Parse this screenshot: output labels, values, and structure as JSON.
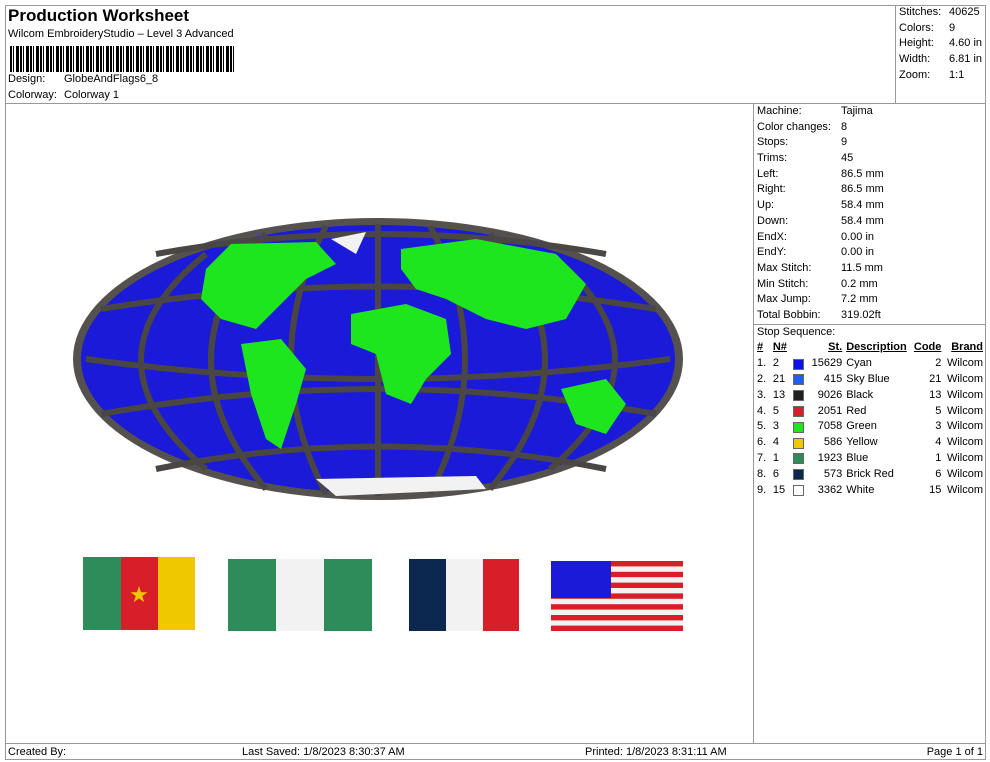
{
  "header": {
    "title": "Production Worksheet",
    "subtitle": "Wilcom EmbroideryStudio – Level 3 Advanced",
    "design_label": "Design:",
    "design": "GlobeAndFlags6_8",
    "colorway_label": "Colorway:",
    "colorway": "Colorway 1"
  },
  "summary": [
    {
      "k": "Stitches:",
      "v": "40625"
    },
    {
      "k": "Colors:",
      "v": "9"
    },
    {
      "k": "Height:",
      "v": "4.60 in"
    },
    {
      "k": "Width:",
      "v": "6.81 in"
    },
    {
      "k": "Zoom:",
      "v": "1:1"
    }
  ],
  "machine": [
    {
      "k": "Machine:",
      "v": "Tajima"
    },
    {
      "k": "Color changes:",
      "v": "8"
    },
    {
      "k": "Stops:",
      "v": "9"
    },
    {
      "k": "Trims:",
      "v": "45"
    },
    {
      "k": "Left:",
      "v": "86.5 mm"
    },
    {
      "k": "Right:",
      "v": "86.5 mm"
    },
    {
      "k": "Up:",
      "v": "58.4 mm"
    },
    {
      "k": "Down:",
      "v": "58.4 mm"
    },
    {
      "k": "EndX:",
      "v": "0.00 in"
    },
    {
      "k": "EndY:",
      "v": "0.00 in"
    },
    {
      "k": "Max Stitch:",
      "v": "11.5 mm"
    },
    {
      "k": "Min Stitch:",
      "v": "0.2 mm"
    },
    {
      "k": "Max Jump:",
      "v": "7.2 mm"
    },
    {
      "k": "Total Bobbin:",
      "v": "319.02ft"
    }
  ],
  "stop_sequence": {
    "title": "Stop Sequence:",
    "headers": [
      "#",
      "N#",
      "St.",
      "Description",
      "Code",
      "Brand"
    ],
    "rows": [
      {
        "i": "1.",
        "n": "2",
        "color": "#0a14e6",
        "st": "15629",
        "desc": "Cyan",
        "code": "2",
        "brand": "Wilcom"
      },
      {
        "i": "2.",
        "n": "21",
        "color": "#1e5ff0",
        "st": "415",
        "desc": "Sky Blue",
        "code": "21",
        "brand": "Wilcom"
      },
      {
        "i": "3.",
        "n": "13",
        "color": "#231f1c",
        "st": "9026",
        "desc": "Black",
        "code": "13",
        "brand": "Wilcom"
      },
      {
        "i": "4.",
        "n": "5",
        "color": "#d81e28",
        "st": "2051",
        "desc": "Red",
        "code": "5",
        "brand": "Wilcom"
      },
      {
        "i": "5.",
        "n": "3",
        "color": "#1ee61e",
        "st": "7058",
        "desc": "Green",
        "code": "3",
        "brand": "Wilcom"
      },
      {
        "i": "6.",
        "n": "4",
        "color": "#f0c800",
        "st": "586",
        "desc": "Yellow",
        "code": "4",
        "brand": "Wilcom"
      },
      {
        "i": "7.",
        "n": "1",
        "color": "#2e8c5a",
        "st": "1923",
        "desc": "Blue",
        "code": "1",
        "brand": "Wilcom"
      },
      {
        "i": "8.",
        "n": "6",
        "color": "#0c2850",
        "st": "573",
        "desc": "Brick Red",
        "code": "6",
        "brand": "Wilcom"
      },
      {
        "i": "9.",
        "n": "15",
        "color": "#ffffff",
        "st": "3362",
        "desc": "White",
        "code": "15",
        "brand": "Wilcom"
      }
    ]
  },
  "footer": {
    "created": "Created By:",
    "saved": "Last Saved: 1/8/2023 8:30:37 AM",
    "printed": "Printed: 1/8/2023 8:31:11 AM",
    "page": "Page 1 of 1"
  }
}
